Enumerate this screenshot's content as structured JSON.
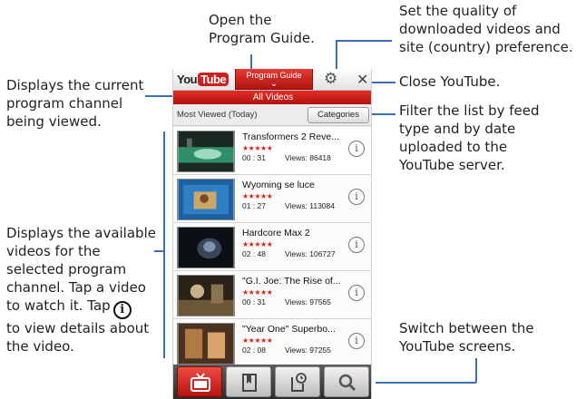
{
  "callouts": {
    "guide": [
      "Open the",
      "Program Guide."
    ],
    "settings": [
      "Set the quality of",
      "downloaded videos and",
      "site (country) preference."
    ],
    "close": [
      "Close YouTube."
    ],
    "channel": [
      "Displays the current",
      "program channel",
      "being viewed."
    ],
    "filter": [
      "Filter the list by feed",
      "type and by date",
      "uploaded to the",
      "YouTube server."
    ],
    "videos": [
      "Displays the available",
      "videos for the",
      "selected program",
      "channel. Tap a video",
      "to watch it. Tap",
      "to view details about",
      "the video."
    ],
    "switch": [
      "Switch between the",
      "YouTube screens."
    ]
  },
  "app": {
    "logo_you": "You",
    "logo_tube": "Tube",
    "guide_button": "Program Guide",
    "channel": "All Videos",
    "feed_label": "Most Viewed (Today)",
    "categories_button": "Categories"
  },
  "videos": [
    {
      "title": "Transformers 2 Reve...",
      "stars": "★★★★★",
      "duration": "00 : 31",
      "views": "Views: 86418"
    },
    {
      "title": "Wyoming se luce",
      "stars": "★★★★★",
      "duration": "01 : 27",
      "views": "Views: 113084"
    },
    {
      "title": "Hardcore Max 2",
      "stars": "★★★★★",
      "duration": "02 : 48",
      "views": "Views: 106727"
    },
    {
      "title": "\"G.I. Joe: The Rise of...",
      "stars": "★★★★★",
      "duration": "00 : 31",
      "views": "Views: 97565"
    },
    {
      "title": "\"Year One\" Superbo...",
      "stars": "★★★★★",
      "duration": "02 : 08",
      "views": "Views: 97255"
    }
  ],
  "tabs": [
    {
      "icon": "tv-icon",
      "active": true
    },
    {
      "icon": "bookmark-icon",
      "active": false
    },
    {
      "icon": "history-icon",
      "active": false
    },
    {
      "icon": "search-icon",
      "active": false
    }
  ],
  "colors": {
    "brand_red": "#cc1f1f",
    "leader_line": "#3a6fb0",
    "star": "#d7261e"
  }
}
